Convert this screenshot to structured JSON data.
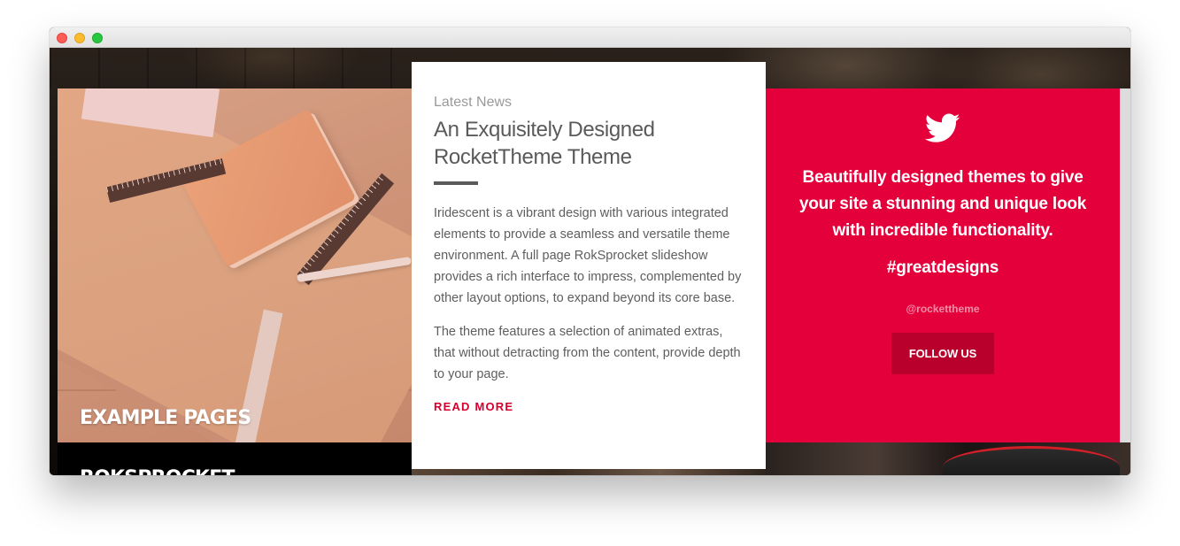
{
  "window": {
    "controls": [
      "close",
      "minimize",
      "zoom"
    ]
  },
  "left_card": {
    "title": "EXAMPLE PAGES",
    "below_title": "ROKSPROCKET"
  },
  "news": {
    "eyebrow": "Latest News",
    "title": "An Exquisitely Designed RocketTheme Theme",
    "paragraph_1": "Iridescent is a vibrant design with various integrated elements to provide a seamless and versatile theme environment. A full page RokSprocket slideshow provides a rich interface to impress, complemented by other layout options, to expand beyond its core base.",
    "paragraph_2": "The theme features a selection of animated extras, that without detracting from the content, provide depth to your page.",
    "read_more": "READ MORE"
  },
  "twitter_card": {
    "icon": "twitter-icon",
    "text": "Beautifully designed themes to give your site a stunning and unique look with incredible functionality.",
    "hashtag": "#greatdesigns",
    "handle": "@rockettheme",
    "button": "FOLLOW US"
  },
  "colors": {
    "accent_red": "#e3003b",
    "button_red": "#b9002c",
    "link_red": "#d6002c",
    "text_gray": "#5a5a5a"
  }
}
